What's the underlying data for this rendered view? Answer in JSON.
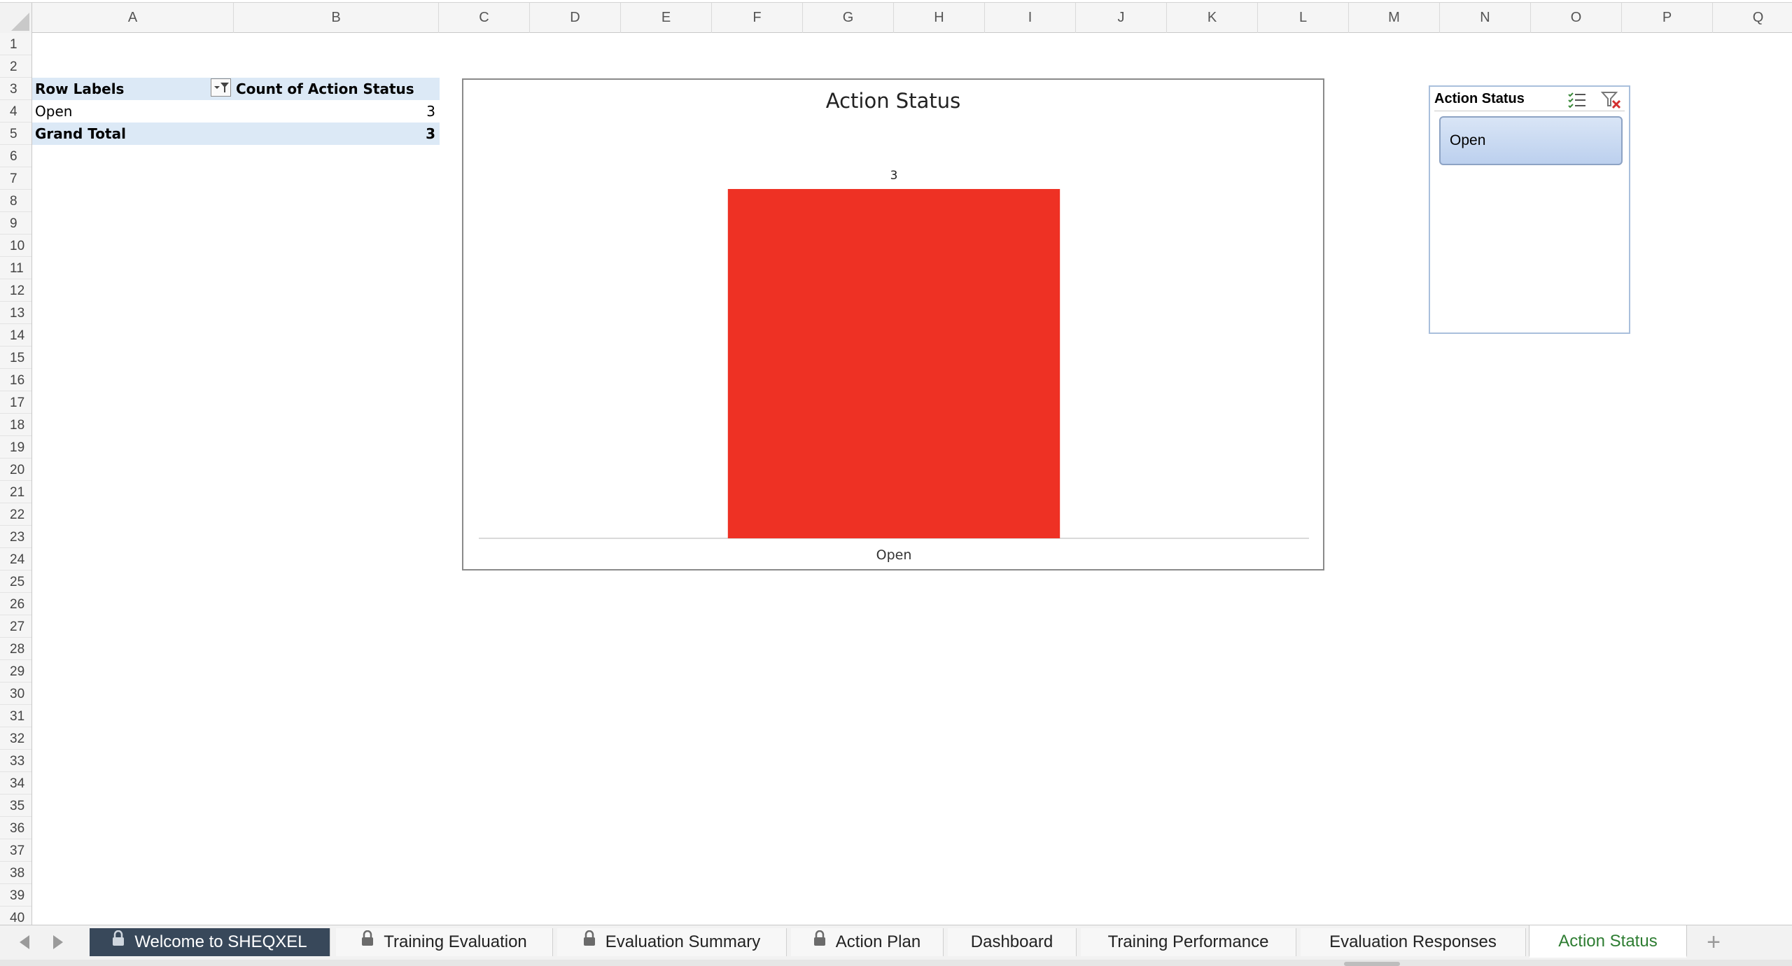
{
  "columns": [
    "A",
    "B",
    "C",
    "D",
    "E",
    "F",
    "G",
    "H",
    "I",
    "J",
    "K",
    "L",
    "M",
    "N",
    "O",
    "P",
    "Q"
  ],
  "rows": [
    "1",
    "2",
    "3",
    "4",
    "5",
    "6",
    "7",
    "8",
    "9",
    "10",
    "11",
    "12",
    "13",
    "14",
    "15",
    "16",
    "17",
    "18",
    "19",
    "20",
    "21",
    "22",
    "23",
    "24",
    "25",
    "26",
    "27",
    "28",
    "29",
    "30",
    "31",
    "32",
    "33",
    "34",
    "35",
    "36",
    "37",
    "38",
    "39",
    "40"
  ],
  "pivot": {
    "row_labels": "Row Labels",
    "count_header": "Count of Action Status",
    "rows": [
      {
        "label": "Open",
        "count": "3"
      }
    ],
    "grand_total_label": "Grand Total",
    "grand_total_value": "3"
  },
  "chart_data": {
    "type": "bar",
    "title": "Action Status",
    "categories": [
      "Open"
    ],
    "values": [
      3
    ],
    "data_labels": [
      "3"
    ],
    "ylim": [
      0,
      3
    ],
    "grid": false,
    "legend": "none",
    "bar_color": "#ee3124"
  },
  "slicer": {
    "title": "Action Status",
    "items": [
      "Open"
    ],
    "multi_select_icon": "multi-select-icon",
    "clear_filter_icon": "clear-filter-icon"
  },
  "tabs": [
    {
      "label": "Welcome to SHEQXEL",
      "locked": true,
      "style": "dark"
    },
    {
      "label": "Training Evaluation",
      "locked": true,
      "style": "normal"
    },
    {
      "label": "Evaluation Summary",
      "locked": true,
      "style": "normal"
    },
    {
      "label": "Action Plan",
      "locked": true,
      "style": "normal"
    },
    {
      "label": "Dashboard",
      "locked": false,
      "style": "normal"
    },
    {
      "label": "Training Performance",
      "locked": false,
      "style": "normal"
    },
    {
      "label": "Evaluation Responses",
      "locked": false,
      "style": "normal"
    },
    {
      "label": "Action Status",
      "locked": false,
      "style": "active"
    }
  ],
  "colors": {
    "pivot_band": "#dce9f6",
    "active_tab_text": "#2e7d32",
    "dark_tab_bg": "#38485a",
    "slicer_item": "#c7d8f1"
  }
}
